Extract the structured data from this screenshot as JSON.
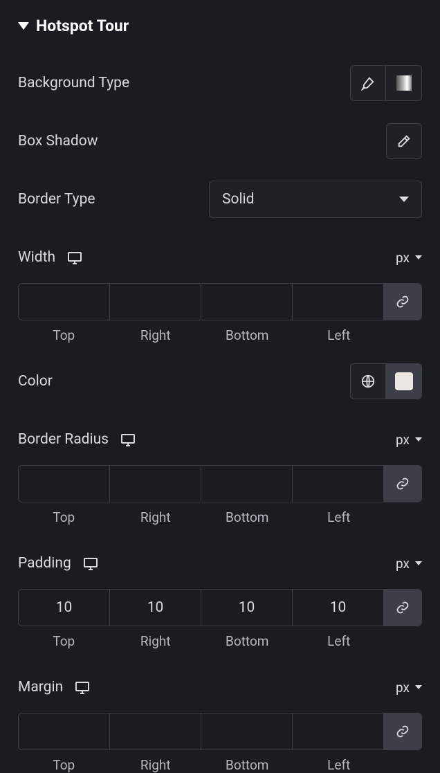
{
  "section": {
    "title": "Hotspot Tour"
  },
  "background_type": {
    "label": "Background Type"
  },
  "box_shadow": {
    "label": "Box Shadow"
  },
  "border_type": {
    "label": "Border Type",
    "value": "Solid"
  },
  "width": {
    "label": "Width",
    "unit": "px",
    "top": "",
    "right": "",
    "bottom": "",
    "left": ""
  },
  "color": {
    "label": "Color",
    "swatch": "#ede7e3"
  },
  "border_radius": {
    "label": "Border Radius",
    "unit": "px",
    "top": "",
    "right": "",
    "bottom": "",
    "left": ""
  },
  "padding": {
    "label": "Padding",
    "unit": "px",
    "top": "10",
    "right": "10",
    "bottom": "10",
    "left": "10"
  },
  "margin": {
    "label": "Margin",
    "unit": "px",
    "top": "",
    "right": "",
    "bottom": "",
    "left": ""
  },
  "dim_labels": {
    "top": "Top",
    "right": "Right",
    "bottom": "Bottom",
    "left": "Left"
  }
}
